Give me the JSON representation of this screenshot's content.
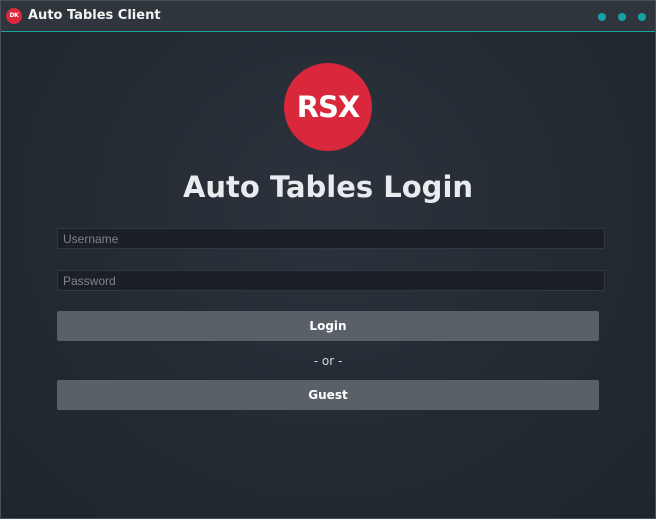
{
  "window": {
    "title": "Auto Tables Client",
    "app_icon_text": "DK",
    "controls": [
      "minimize",
      "maximize",
      "close"
    ],
    "accent_color": "#15a3a8"
  },
  "login": {
    "logo_text": "RSX",
    "logo_color": "#d9283c",
    "heading": "Auto Tables Login",
    "username_placeholder": "Username",
    "username_value": "",
    "password_placeholder": "Password",
    "password_value": "",
    "login_label": "Login",
    "separator": "- or -",
    "guest_label": "Guest"
  }
}
